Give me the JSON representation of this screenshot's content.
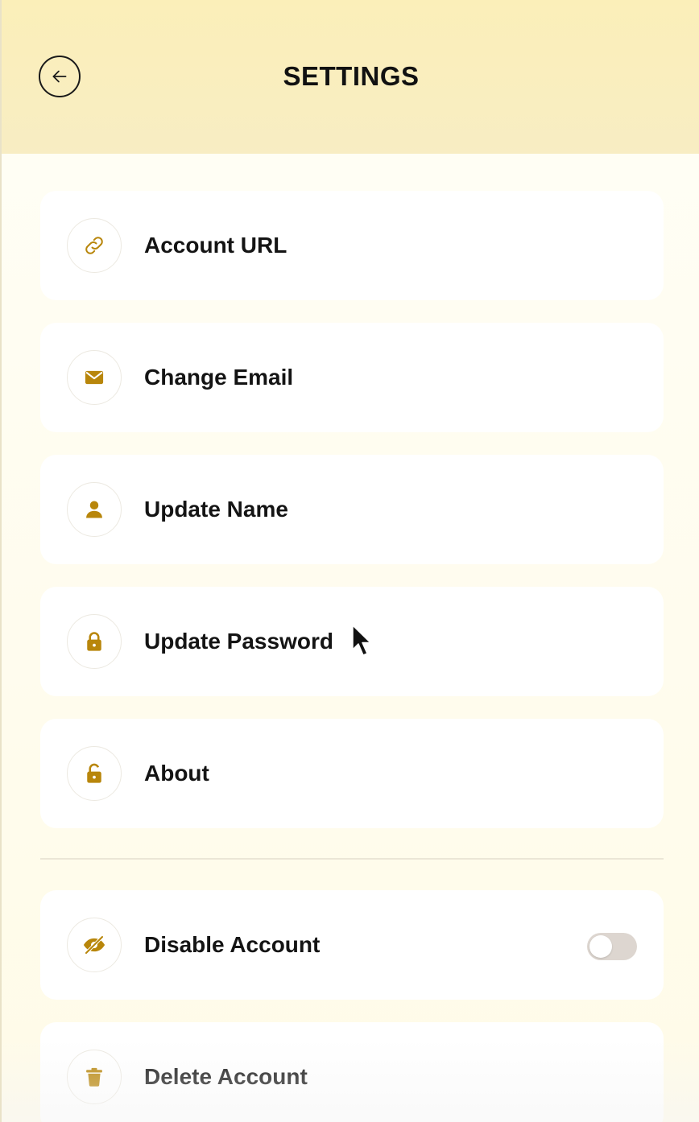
{
  "header": {
    "title": "SETTINGS"
  },
  "colors": {
    "accent": "#b8860b",
    "header_bg": "#f9eec0",
    "toggle_off": "#ddd6d0"
  },
  "items": [
    {
      "label": "Account URL",
      "icon": "link-icon"
    },
    {
      "label": "Change Email",
      "icon": "mail-icon"
    },
    {
      "label": "Update Name",
      "icon": "user-icon"
    },
    {
      "label": "Update Password",
      "icon": "lock-icon"
    },
    {
      "label": "About",
      "icon": "unlock-icon"
    }
  ],
  "danger_items": [
    {
      "label": "Disable Account",
      "icon": "eye-off-icon",
      "toggle_on": false
    },
    {
      "label": "Delete Account",
      "icon": "trash-icon"
    }
  ]
}
